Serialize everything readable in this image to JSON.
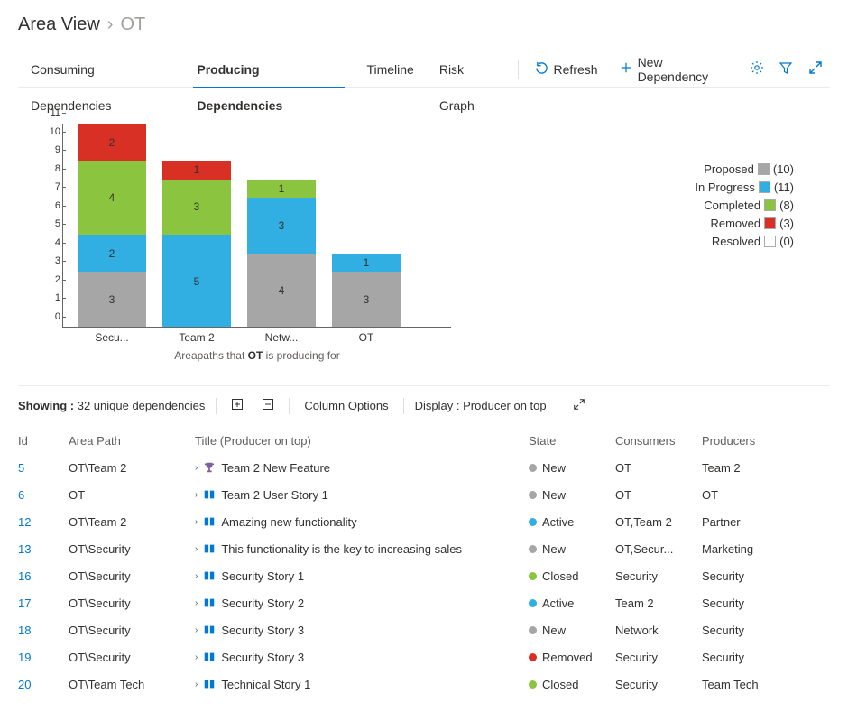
{
  "breadcrumb": {
    "main": "Area View",
    "sub": "OT"
  },
  "tabs": [
    "Consuming Dependencies",
    "Producing Dependencies",
    "Timeline",
    "Risk Graph"
  ],
  "active_tab": 1,
  "actions": {
    "refresh": "Refresh",
    "new_dep": "New Dependency"
  },
  "chart_data": {
    "type": "bar",
    "stacked": true,
    "title": "",
    "xlabel_html": "Areapaths that <b>OT</b> is producing for",
    "ylabel": "",
    "ylim": [
      0,
      11
    ],
    "yticks": [
      0,
      1,
      2,
      3,
      4,
      5,
      6,
      7,
      8,
      9,
      10,
      11
    ],
    "categories": [
      "Secu...",
      "Team 2",
      "Netw...",
      "OT"
    ],
    "series": [
      {
        "name": "Proposed",
        "color": "#a6a6a6",
        "total": 10,
        "values": [
          3,
          0,
          4,
          3
        ]
      },
      {
        "name": "In Progress",
        "color": "#31aee2",
        "total": 11,
        "values": [
          2,
          5,
          3,
          1
        ]
      },
      {
        "name": "Completed",
        "color": "#8bc540",
        "total": 8,
        "values": [
          4,
          3,
          1,
          0
        ]
      },
      {
        "name": "Removed",
        "color": "#d93025",
        "total": 3,
        "values": [
          2,
          1,
          0,
          0
        ]
      },
      {
        "name": "Resolved",
        "color": "#ffffff",
        "total": 0,
        "values": [
          0,
          0,
          0,
          0
        ]
      }
    ]
  },
  "legend": [
    {
      "label": "Proposed",
      "count": 10,
      "color": "#a6a6a6"
    },
    {
      "label": "In Progress",
      "count": 11,
      "color": "#31aee2"
    },
    {
      "label": "Completed",
      "count": 8,
      "color": "#8bc540"
    },
    {
      "label": "Removed",
      "count": 3,
      "color": "#d93025"
    },
    {
      "label": "Resolved",
      "count": 0,
      "color": "#ffffff"
    }
  ],
  "list_toolbar": {
    "showing_prefix": "Showing :",
    "showing_value": "32 unique dependencies",
    "column_options": "Column Options",
    "display_prefix": "Display :",
    "display_value": "Producer on top"
  },
  "columns": [
    "Id",
    "Area Path",
    "Title (Producer on top)",
    "State",
    "Consumers",
    "Producers"
  ],
  "state_colors": {
    "New": "#a6a6a6",
    "Active": "#31aee2",
    "Closed": "#8bc540",
    "Removed": "#d93025"
  },
  "rows": [
    {
      "id": 5,
      "area": "OT\\Team 2",
      "icon": "trophy",
      "title": "Team 2 New Feature",
      "state": "New",
      "consumers": "OT",
      "producers": "Team 2"
    },
    {
      "id": 6,
      "area": "OT",
      "icon": "story",
      "title": "Team 2 User Story 1",
      "state": "New",
      "consumers": "OT",
      "producers": "OT"
    },
    {
      "id": 12,
      "area": "OT\\Team 2",
      "icon": "story",
      "title": "Amazing new functionality",
      "state": "Active",
      "consumers": "OT,Team 2",
      "producers": "Partner"
    },
    {
      "id": 13,
      "area": "OT\\Security",
      "icon": "story",
      "title": "This functionality is the key to increasing sales",
      "state": "New",
      "consumers": "OT,Secur...",
      "producers": "Marketing"
    },
    {
      "id": 16,
      "area": "OT\\Security",
      "icon": "story",
      "title": "Security Story 1",
      "state": "Closed",
      "consumers": "Security",
      "producers": "Security"
    },
    {
      "id": 17,
      "area": "OT\\Security",
      "icon": "story",
      "title": "Security Story 2",
      "state": "Active",
      "consumers": "Team 2",
      "producers": "Security"
    },
    {
      "id": 18,
      "area": "OT\\Security",
      "icon": "story",
      "title": "Security Story 3",
      "state": "New",
      "consumers": "Network",
      "producers": "Security"
    },
    {
      "id": 19,
      "area": "OT\\Security",
      "icon": "story",
      "title": "Security Story 3",
      "state": "Removed",
      "consumers": "Security",
      "producers": "Security"
    },
    {
      "id": 20,
      "area": "OT\\Team Tech",
      "icon": "story",
      "title": "Technical Story 1",
      "state": "Closed",
      "consumers": "Security",
      "producers": "Team Tech"
    }
  ]
}
